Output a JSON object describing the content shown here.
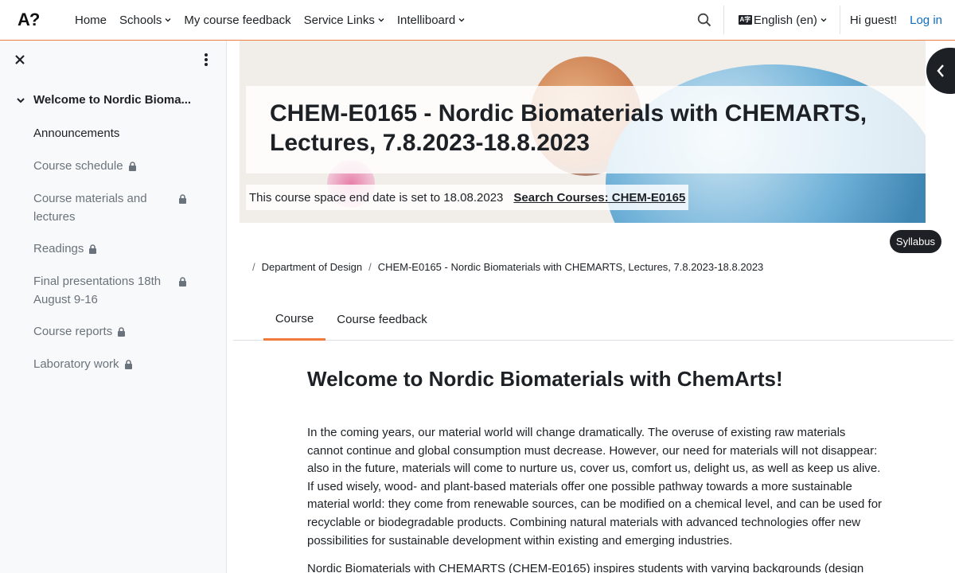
{
  "nav": {
    "logo": "A?",
    "links": [
      {
        "label": "Home",
        "dropdown": false
      },
      {
        "label": "Schools",
        "dropdown": true
      },
      {
        "label": "My course feedback",
        "dropdown": false
      },
      {
        "label": "Service Links",
        "dropdown": true
      },
      {
        "label": "Intelliboard",
        "dropdown": true
      }
    ],
    "language": "English (en)",
    "greeting": "Hi guest!",
    "login": "Log in"
  },
  "drawer": {
    "section_title": "Welcome to Nordic Bioma...",
    "items": [
      {
        "label": "Announcements",
        "locked": false
      },
      {
        "label": "Course schedule",
        "locked": true
      },
      {
        "label": "Course materials and lectures",
        "locked": true
      },
      {
        "label": "Readings",
        "locked": true
      },
      {
        "label": "Final presentations 18th August 9-16",
        "locked": true
      },
      {
        "label": "Course reports",
        "locked": true
      },
      {
        "label": "Laboratory work",
        "locked": true
      }
    ]
  },
  "header": {
    "title": "CHEM-E0165 - Nordic Biomaterials with CHEMARTS, Lectures, 7.8.2023-18.8.2023",
    "end_date_note": "This course space end date is set to 18.08.2023",
    "search_link": "Search Courses: CHEM-E0165",
    "syllabus": "Syllabus"
  },
  "breadcrumb": [
    "Department of Design",
    "CHEM-E0165 - Nordic Biomaterials with CHEMARTS, Lectures, 7.8.2023-18.8.2023"
  ],
  "tabs": [
    {
      "label": "Course",
      "active": true
    },
    {
      "label": "Course feedback",
      "active": false
    }
  ],
  "content": {
    "heading": "Welcome to Nordic Biomaterials with ChemArts!",
    "paragraphs": [
      "In the coming years, our material world will change dramatically. The overuse of existing raw materials cannot continue and global consumption must decrease. However, our need for materials will not disappear: also in the future, materials will come to nurture us, cover us, comfort us, delight us, as well as keep us alive. If used wisely, wood- and plant-based materials offer one possible pathway towards a more sustainable material world: they come from renewable sources, can be modified on a chemical level, and can be used for recyclable or biodegradable products. Combining natural materials with advanced technologies offer new possibilities for sustainable development within existing and emerging industries.",
      "Nordic Biomaterials with CHEMARTS (CHEM-E0165) inspires students with varying backgrounds (design"
    ]
  },
  "colors": {
    "accent": "#f07c3c",
    "link": "#0f6cbf",
    "dark": "#1d2125",
    "muted": "#6a737b"
  }
}
